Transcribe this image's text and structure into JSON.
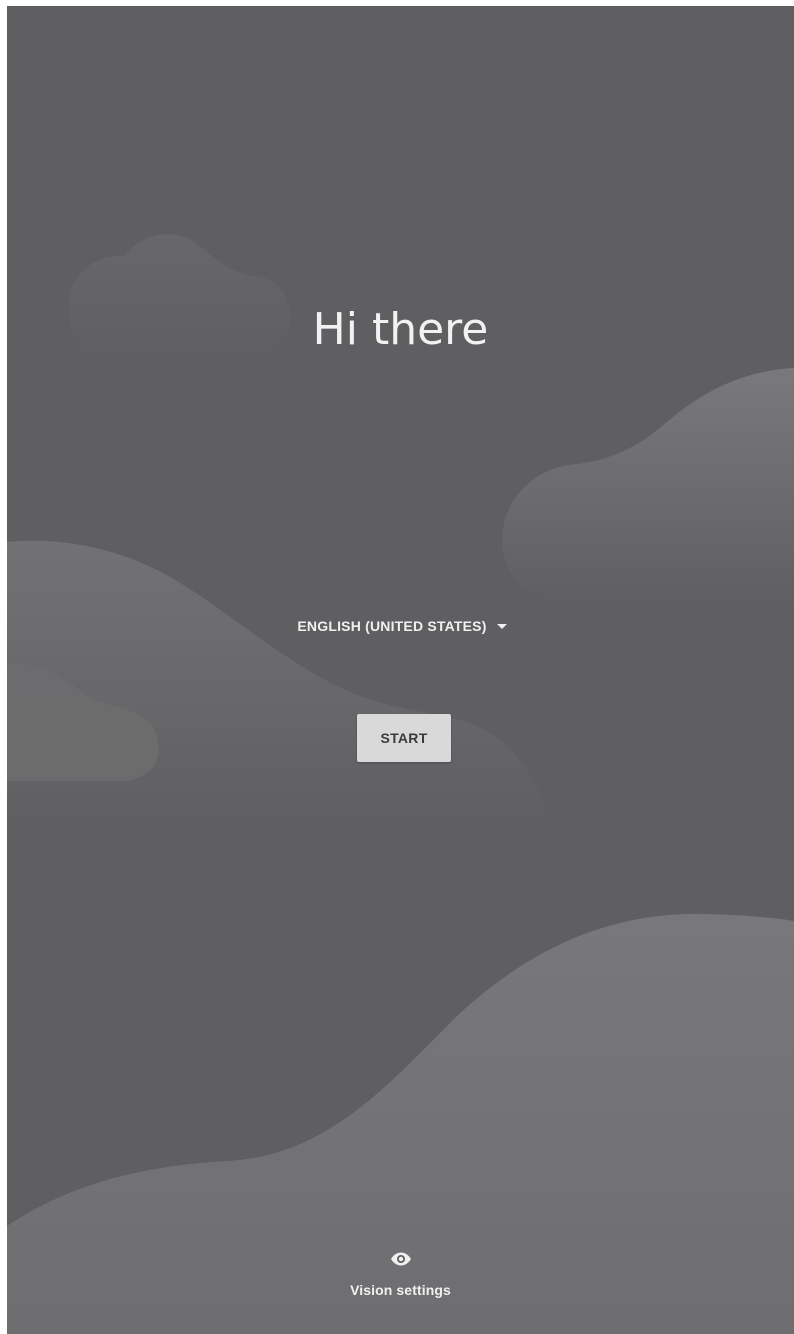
{
  "welcome": {
    "title": "Hi there"
  },
  "language": {
    "selected": "ENGLISH (UNITED STATES)",
    "icon": "dropdown-caret-icon"
  },
  "start": {
    "label": "START"
  },
  "vision_settings": {
    "label": "Vision settings",
    "icon": "eye-icon"
  },
  "colors": {
    "background": "#5f5f61",
    "hill_light": "#737375",
    "button_bg": "#d9d9d9",
    "text": "#f2f2f2"
  }
}
